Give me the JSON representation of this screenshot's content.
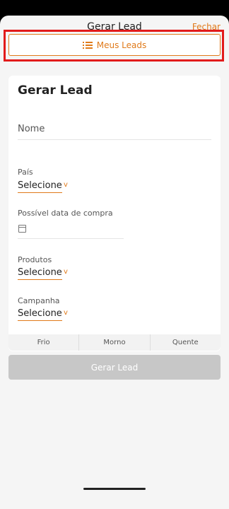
{
  "header": {
    "title": "Gerar Lead",
    "close_label": "Fechar"
  },
  "my_leads_button": {
    "label": "Meus Leads",
    "icon": "list-icon"
  },
  "form": {
    "title": "Gerar Lead",
    "name_placeholder": "Nome",
    "country": {
      "label": "País",
      "value": "Selecione"
    },
    "purchase_date": {
      "label": "Possível data de compra",
      "icon": "calendar-icon"
    },
    "products": {
      "label": "Produtos",
      "value": "Selecione"
    },
    "campaign": {
      "label": "Campanha",
      "value": "Selecione"
    },
    "temperature": [
      "Frio",
      "Morno",
      "Quente"
    ]
  },
  "submit_label": "Gerar Lead",
  "colors": {
    "accent": "#e07a1a",
    "highlight": "#e21b1b",
    "disabled": "#c7c7c7"
  }
}
